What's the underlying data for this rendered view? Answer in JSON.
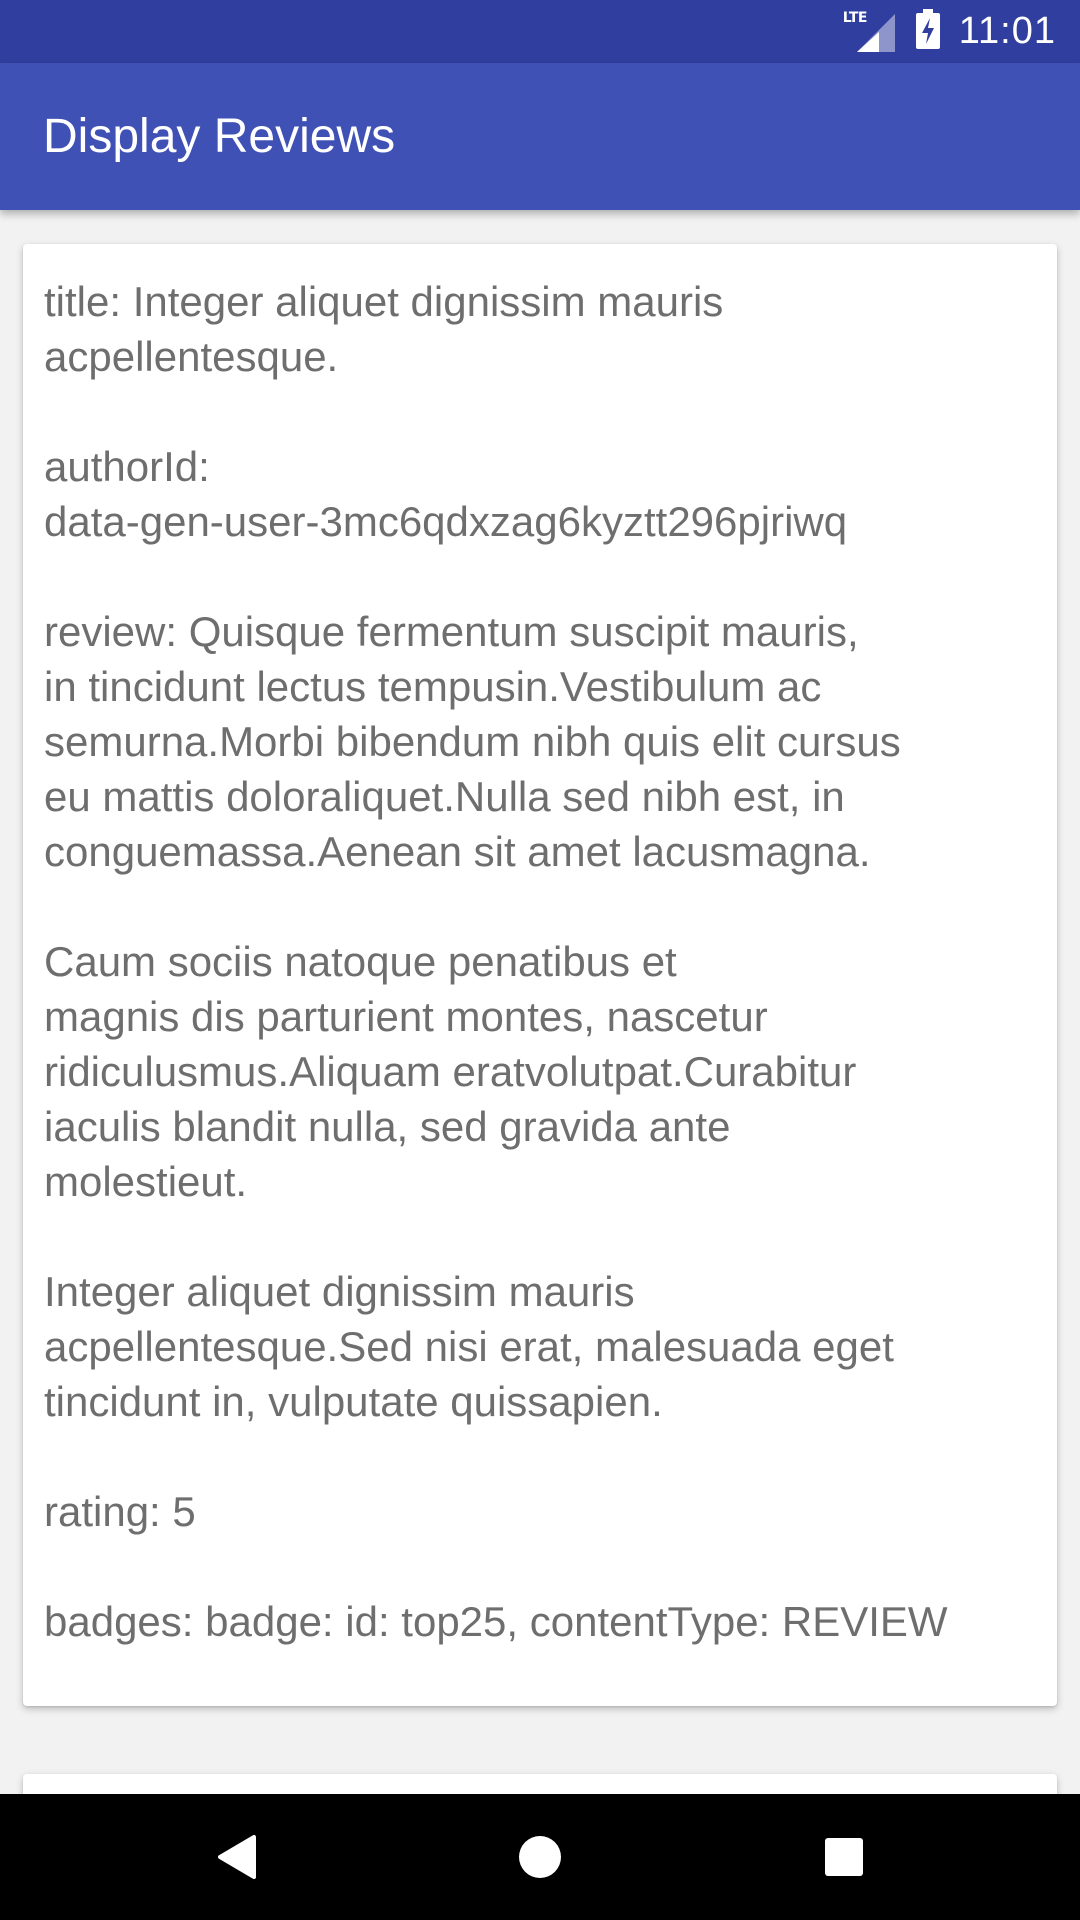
{
  "status_bar": {
    "network": "LTE",
    "time": "11:01",
    "icons": [
      "lte-signal-icon",
      "battery-charging-icon"
    ]
  },
  "app_bar": {
    "title": "Display Reviews"
  },
  "reviews": [
    {
      "text": "title: Integer aliquet dignissim mauris\nacpellentesque.\n\nauthorId:\ndata-gen-user-3mc6qdxzag6kyztt296pjriwq\n\nreview: Quisque fermentum suscipit mauris,\nin tincidunt lectus tempusin.Vestibulum ac\nsemurna.Morbi bibendum nibh quis elit cursus\neu mattis doloraliquet.Nulla sed nibh est, in\nconguemassa.Aenean sit amet lacusmagna.\n\nCaum sociis natoque penatibus et\nmagnis dis parturient montes, nascetur\nridiculusmus.Aliquam eratvolutpat.Curabitur\niaculis blandit nulla, sed gravida ante\nmolestieut.\n\nInteger aliquet dignissim mauris\nacpellentesque.Sed nisi erat, malesuada eget\ntincidunt in, vulputate quissapien.\n\nrating: 5\n\nbadges: badge: id: top25, contentType: REVIEW"
    }
  ],
  "nav_bar": {
    "icons": [
      "back-icon",
      "home-icon",
      "recents-icon"
    ]
  },
  "colors": {
    "status_bar": "#303f9f",
    "app_bar": "#3f51b5",
    "background": "#f2f2f2",
    "card": "#ffffff",
    "text": "#6e6e6e"
  }
}
